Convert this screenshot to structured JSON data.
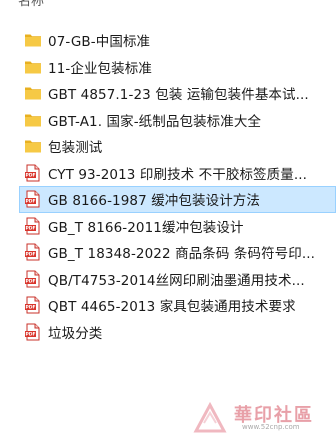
{
  "header": {
    "column_name": "名称"
  },
  "files": [
    {
      "name": "07-GB-中国标准",
      "type": "folder",
      "icon": "folder-icon"
    },
    {
      "name": "11-企业包装标准",
      "type": "folder",
      "icon": "folder-icon"
    },
    {
      "name": "GBT 4857.1-23 包装 运输包装件基本试...",
      "type": "folder",
      "icon": "folder-icon"
    },
    {
      "name": "GBT-A1. 国家-纸制品包装标准大全",
      "type": "folder",
      "icon": "folder-icon"
    },
    {
      "name": "包装测试",
      "type": "folder",
      "icon": "folder-icon"
    },
    {
      "name": "CYT 93-2013 印刷技术 不干胶标签质量...",
      "type": "pdf",
      "icon": "pdf-icon"
    },
    {
      "name": "GB 8166-1987 缓冲包装设计方法",
      "type": "pdf",
      "icon": "pdf-icon",
      "selected": true
    },
    {
      "name": "GB_T 8166-2011缓冲包装设计",
      "type": "pdf",
      "icon": "pdf-icon"
    },
    {
      "name": "GB_T 18348-2022 商品条码 条码符号印...",
      "type": "pdf",
      "icon": "pdf-icon"
    },
    {
      "name": "QB/T4753-2014丝网印刷油墨通用技术...",
      "type": "pdf",
      "icon": "pdf-icon"
    },
    {
      "name": "QBT 4465-2013 家具包装通用技术要求",
      "type": "pdf",
      "icon": "pdf-icon"
    },
    {
      "name": "垃圾分类",
      "type": "pdf",
      "icon": "pdf-icon"
    }
  ],
  "watermark": {
    "text": "華印社區",
    "url": "www.52cnp.com"
  },
  "colors": {
    "selection_bg": "#cce8ff",
    "selection_border": "#99d1ff",
    "folder_yellow": "#f4c542",
    "pdf_red": "#d9342b"
  }
}
